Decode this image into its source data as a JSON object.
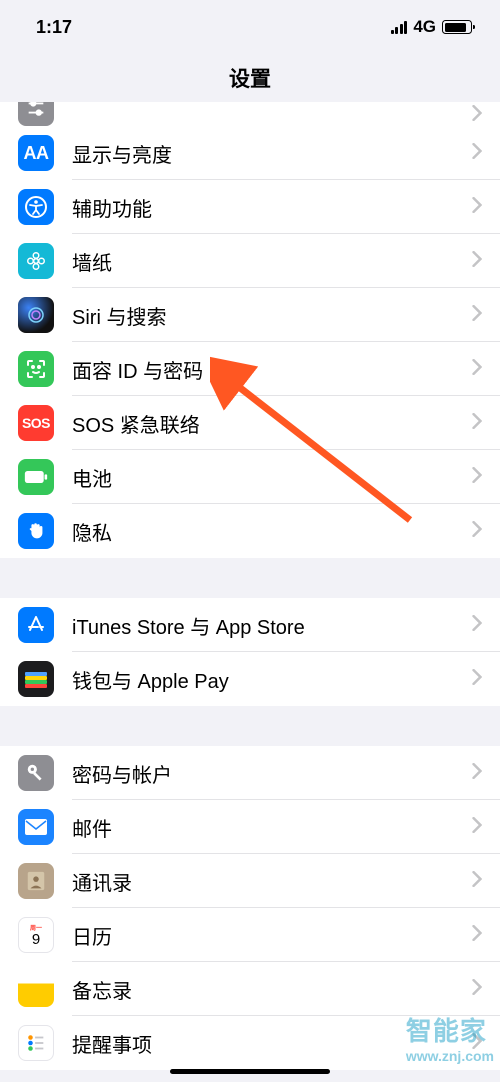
{
  "status": {
    "time": "1:17",
    "network": "4G"
  },
  "title": "设置",
  "groups": [
    {
      "partialTop": {
        "id": "control-center",
        "label": "",
        "iconBg": "bg-grey",
        "svg": "sliders"
      },
      "items": [
        {
          "id": "display",
          "label": "显示与亮度",
          "iconBg": "bg-blue",
          "iconText": "AA"
        },
        {
          "id": "accessibility",
          "label": "辅助功能",
          "iconBg": "bg-blue",
          "svg": "accessibility"
        },
        {
          "id": "wallpaper",
          "label": "墙纸",
          "iconBg": "bg-cyan",
          "svg": "flower"
        },
        {
          "id": "siri",
          "label": "Siri 与搜索",
          "iconBg": "bg-siri",
          "svg": "siri"
        },
        {
          "id": "faceid",
          "label": "面容 ID 与密码",
          "iconBg": "bg-green",
          "svg": "face"
        },
        {
          "id": "sos",
          "label": "SOS 紧急联络",
          "iconBg": "bg-red",
          "iconText": "SOS",
          "small": true
        },
        {
          "id": "battery",
          "label": "电池",
          "iconBg": "bg-green",
          "svg": "battery"
        },
        {
          "id": "privacy",
          "label": "隐私",
          "iconBg": "bg-blue",
          "svg": "hand"
        }
      ]
    },
    {
      "items": [
        {
          "id": "appstore",
          "label": "iTunes Store 与 App Store",
          "iconBg": "bg-blue",
          "svg": "appstore"
        },
        {
          "id": "wallet",
          "label": "钱包与 Apple Pay",
          "iconBg": "bg-wallet",
          "svg": "wallet"
        }
      ]
    },
    {
      "items": [
        {
          "id": "passwords",
          "label": "密码与帐户",
          "iconBg": "bg-key",
          "svg": "key"
        },
        {
          "id": "mail",
          "label": "邮件",
          "iconBg": "bg-mail",
          "svg": "mail"
        },
        {
          "id": "contacts",
          "label": "通讯录",
          "iconBg": "bg-contacts",
          "svg": "contacts"
        },
        {
          "id": "calendar",
          "label": "日历",
          "iconBg": "bg-cal",
          "svg": "calendar"
        },
        {
          "id": "notes",
          "label": "备忘录",
          "iconBg": "bg-notes",
          "svg": ""
        },
        {
          "id": "reminders",
          "label": "提醒事项",
          "iconBg": "bg-reminders",
          "svg": "reminders"
        }
      ]
    }
  ],
  "watermark": {
    "text": "智能家",
    "url": "www.znj.com"
  }
}
